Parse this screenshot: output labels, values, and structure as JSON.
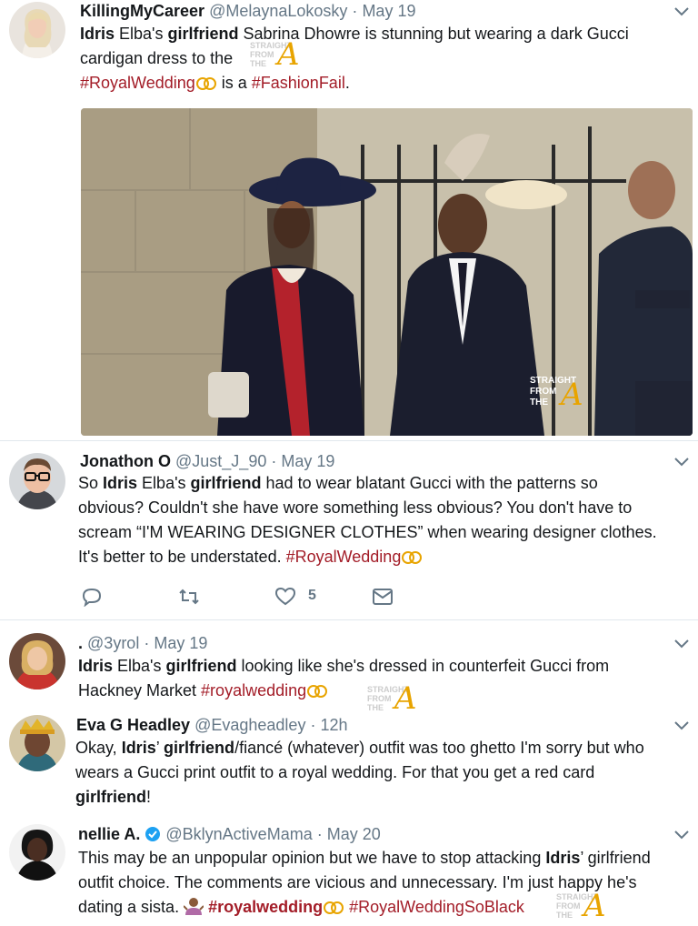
{
  "tweets": [
    {
      "name": "KillingMyCareer",
      "handle": "@MelaynaLokosky",
      "time": "May 19",
      "text": {
        "l1_b1": "Idris",
        "l1_t1": " Elba's ",
        "l1_b2": "girlfriend",
        "l1_t2": " Sabrina Dhowre is stunning but wearing a dark Gucci",
        "l2": "cardigan dress to the",
        "l3_tag1": "#RoyalWedding",
        "l3_t1": " is a ",
        "l3_tag2": "#FashionFail",
        "l3_t2": "."
      }
    },
    {
      "name": "Jonathon O",
      "handle": "@Just_J_90",
      "time": "May 19",
      "text": {
        "l1_t1": "So ",
        "l1_b1": "Idris",
        "l1_t2": " Elba's ",
        "l1_b2": "girlfriend",
        "l1_t3": " had to wear blatant Gucci with the patterns so",
        "l2": "obvious? Couldn't she have wore something less obvious? You don't have to",
        "l3": "scream “I'M WEARING DESIGNER CLOTHES” when wearing designer clothes.",
        "l4_t1": "It's better to be understated. ",
        "l4_tag": "#RoyalWedding"
      },
      "like_count": "5"
    },
    {
      "name": ".",
      "handle": "@3yrol",
      "time": "May 19",
      "text": {
        "l1_b1": "Idris",
        "l1_t1": " Elba's ",
        "l1_b2": "girlfriend",
        "l1_t2": " looking like she's dressed in counterfeit Gucci from",
        "l2_t1": "Hackney Market ",
        "l2_tag": "#royalwedding"
      }
    },
    {
      "name": "Eva G Headley",
      "handle": "@Evagheadley",
      "time": "12h",
      "text": {
        "l1_t1": "Okay, ",
        "l1_b1": "Idris",
        "l1_t2": "’ ",
        "l1_b2": "girlfriend",
        "l1_t3": "/fiancé (whatever) outfit was too ghetto I'm sorry but who",
        "l2": "wears a Gucci print outfit to a royal wedding. For that you get a red card",
        "l3_b1": "girlfriend",
        "l3_t1": "!"
      }
    },
    {
      "name": "nellie A.",
      "handle": "@BklynActiveMama",
      "time": "May 20",
      "text": {
        "l1_t1": "This may be an unpopular opinion but we have to stop attacking ",
        "l1_b1": "Idris",
        "l1_t2": "’ girlfriend",
        "l2": "outfit choice. The comments are vicious and unnecessary. I'm just happy he's",
        "l3_t1": "dating a sista. ",
        "l3_tag1": "#royalwedding",
        "l3_tag2": "#RoyalWeddingSoBlack"
      }
    }
  ],
  "watermark": {
    "line1": "STRAIGHT",
    "line2": "FROM",
    "line3": "THE",
    "letter": "A"
  },
  "colors": {
    "hashtag": "#a31d28",
    "muted": "#657786",
    "verified": "#1da1f2",
    "gold": "#e8a400"
  }
}
